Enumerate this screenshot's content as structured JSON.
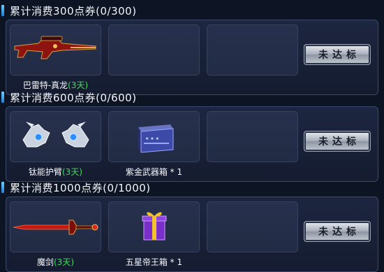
{
  "tiers": [
    {
      "title": "累计消费300点券(0/300)",
      "button": "未达标",
      "items": [
        {
          "name": "巴雷特-真龙",
          "days": "(3天)",
          "icon": "sniper-rifle-icon"
        }
      ]
    },
    {
      "title": "累计消费600点券(0/600)",
      "button": "未达标",
      "items": [
        {
          "name": "钛能护臂",
          "days": "(3天)",
          "icon": "gauntlet-icon"
        },
        {
          "name": "紫金武器箱 * 1",
          "days": "",
          "icon": "weapon-box-icon"
        }
      ]
    },
    {
      "title": "累计消费1000点券(0/1000)",
      "button": "未达标",
      "items": [
        {
          "name": "魔剑",
          "days": "(3天)",
          "icon": "sword-icon"
        },
        {
          "name": "五星帝王箱 * 1",
          "days": "",
          "icon": "gift-box-icon"
        }
      ]
    }
  ]
}
